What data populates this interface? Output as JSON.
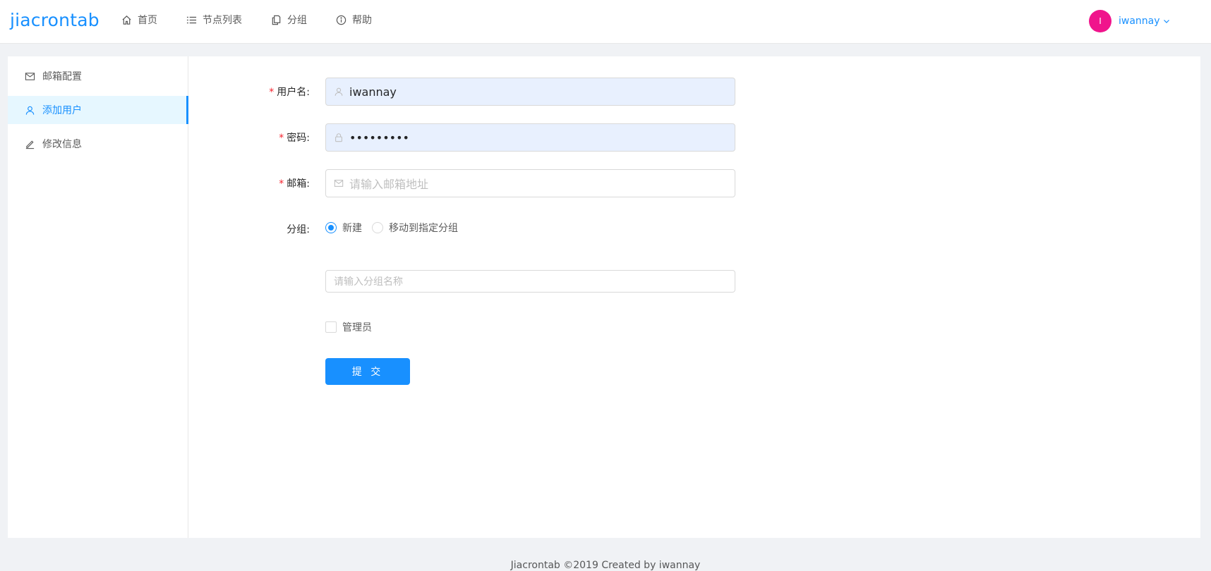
{
  "app": {
    "logo": "jiacrontab"
  },
  "nav": {
    "items": [
      {
        "label": "首页",
        "icon": "home-icon"
      },
      {
        "label": "节点列表",
        "icon": "list-icon"
      },
      {
        "label": "分组",
        "icon": "copy-icon"
      },
      {
        "label": "帮助",
        "icon": "info-icon"
      }
    ]
  },
  "user": {
    "avatar_initial": "I",
    "name": "iwannay",
    "avatar_color": "#f0148c"
  },
  "sidebar": {
    "items": [
      {
        "label": "邮箱配置",
        "icon": "mail-icon",
        "active": false
      },
      {
        "label": "添加用户",
        "icon": "user-icon",
        "active": true
      },
      {
        "label": "修改信息",
        "icon": "edit-icon",
        "active": false
      }
    ]
  },
  "form": {
    "username": {
      "label": "用户名:",
      "value": "iwannay"
    },
    "password": {
      "label": "密码:",
      "value": "•••••••••"
    },
    "email": {
      "label": "邮箱:",
      "placeholder": "请输入邮箱地址"
    },
    "group": {
      "label": "分组:",
      "options": [
        "新建",
        "移动到指定分组"
      ],
      "selected": "新建",
      "name_placeholder": "请输入分组名称"
    },
    "admin_label": "管理员",
    "submit_label": "提 交"
  },
  "footer": {
    "text": "Jiacrontab ©2019 Created by iwannay"
  },
  "colors": {
    "accent": "#1890ff",
    "required": "#f5222d",
    "autofill_bg": "#e8f0fe"
  }
}
